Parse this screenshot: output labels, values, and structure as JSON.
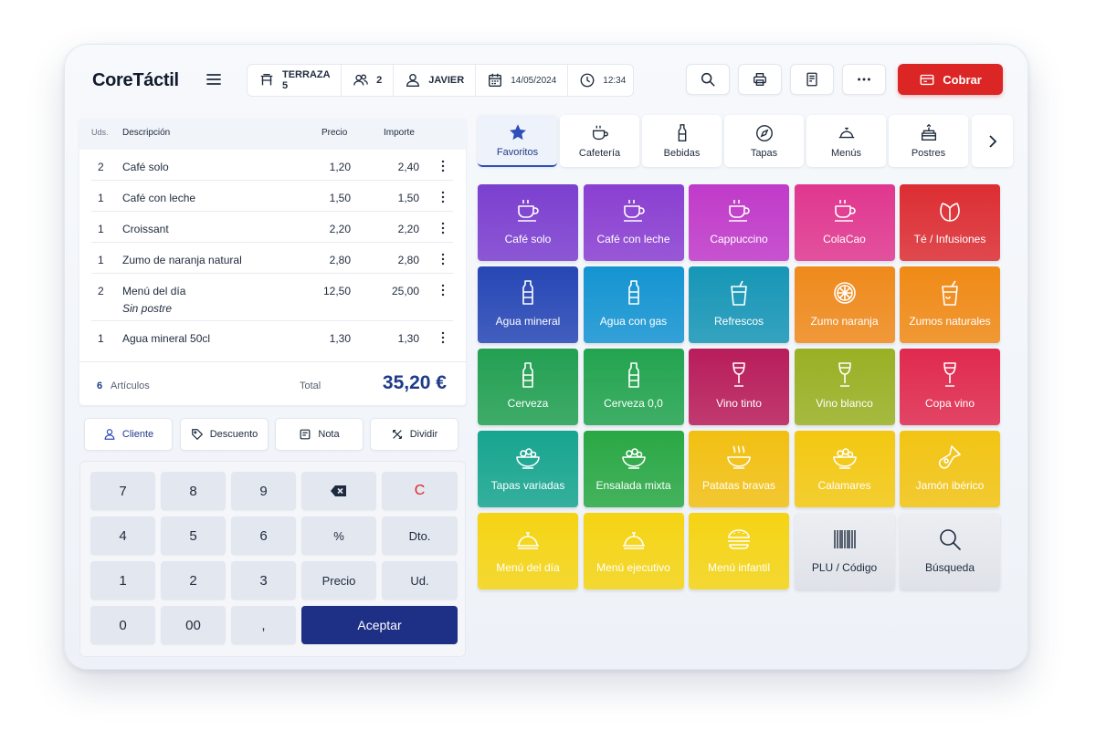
{
  "brand": "CoreTáctil",
  "info": {
    "table": "TERRAZA 5",
    "guests": "2",
    "waiter": "JAVIER",
    "date": "14/05/2024",
    "time": "12:34"
  },
  "cobrar_label": "Cobrar",
  "ticket": {
    "headers": {
      "units": "Uds.",
      "description": "Descripción",
      "price": "Precio",
      "amount": "Importe"
    },
    "rows": [
      {
        "qty": "2",
        "desc": "Café solo",
        "note": "",
        "price": "1,20",
        "amount": "2,40"
      },
      {
        "qty": "1",
        "desc": "Café con leche",
        "note": "",
        "price": "1,50",
        "amount": "1,50"
      },
      {
        "qty": "1",
        "desc": "Croissant",
        "note": "",
        "price": "2,20",
        "amount": "2,20"
      },
      {
        "qty": "1",
        "desc": "Zumo de naranja natural",
        "note": "",
        "price": "2,80",
        "amount": "2,80"
      },
      {
        "qty": "2",
        "desc": "Menú del día",
        "note": "Sin postre",
        "price": "12,50",
        "amount": "25,00"
      },
      {
        "qty": "1",
        "desc": "Agua mineral 50cl",
        "note": "",
        "price": "1,30",
        "amount": "1,30"
      }
    ],
    "count": "6",
    "count_label": "Artículos",
    "total_label": "Total",
    "total": "35,20 €"
  },
  "actions": {
    "cliente": "Cliente",
    "descuento": "Descuento",
    "nota": "Nota",
    "dividir": "Dividir"
  },
  "keypad": {
    "k7": "7",
    "k8": "8",
    "k9": "9",
    "clear": "C",
    "k4": "4",
    "k5": "5",
    "k6": "6",
    "percent": "%",
    "dto": "Dto.",
    "k1": "1",
    "k2": "2",
    "k3": "3",
    "precio": "Precio",
    "ud": "Ud.",
    "k0": "0",
    "k00": "00",
    "comma": ",",
    "aceptar": "Aceptar"
  },
  "categories": [
    "Favoritos",
    "Cafetería",
    "Bebidas",
    "Tapas",
    "Menús",
    "Postres"
  ],
  "products": [
    {
      "label": "Café solo",
      "icon": "cup-icon",
      "color": "#7c3fcf"
    },
    {
      "label": "Café con leche",
      "icon": "cup-icon",
      "color": "#8a3fd1"
    },
    {
      "label": "Cappuccino",
      "icon": "cup-icon",
      "color": "#c03ac9"
    },
    {
      "label": "ColaCao",
      "icon": "cup-icon",
      "color": "#e0378f"
    },
    {
      "label": "Té / Infusiones",
      "icon": "leaf-icon",
      "color": "#dc2e33"
    },
    {
      "label": "Agua mineral",
      "icon": "bottle-icon",
      "color": "#2747b5"
    },
    {
      "label": "Agua con gas",
      "icon": "bottle-icon",
      "color": "#1594d1"
    },
    {
      "label": "Refrescos",
      "icon": "soda-cup-icon",
      "color": "#1796b6"
    },
    {
      "label": "Zumo naranja",
      "icon": "orange-slice-icon",
      "color": "#ef8a1c"
    },
    {
      "label": "Zumos naturales",
      "icon": "juice-glass-icon",
      "color": "#f08a16"
    },
    {
      "label": "Cerveza",
      "icon": "beer-bottle-icon",
      "color": "#23a052"
    },
    {
      "label": "Cerveza 0,0",
      "icon": "beer-bottle-icon",
      "color": "#23a44f"
    },
    {
      "label": "Vino tinto",
      "icon": "wine-glass-icon",
      "color": "#b81d5a"
    },
    {
      "label": "Vino blanco",
      "icon": "wine-glass-icon",
      "color": "#9ab024"
    },
    {
      "label": "Copa vino",
      "icon": "wine-glass-icon",
      "color": "#e02a4e"
    },
    {
      "label": "Tapas variadas",
      "icon": "bowl-icon",
      "color": "#17a58f"
    },
    {
      "label": "Ensalada mixta",
      "icon": "bowl-icon",
      "color": "#2aa845"
    },
    {
      "label": "Patatas bravas",
      "icon": "steaming-bowl-icon",
      "color": "#f2c013"
    },
    {
      "label": "Calamares",
      "icon": "bowl-icon",
      "color": "#f3c812"
    },
    {
      "label": "Jamón ibérico",
      "icon": "ham-icon",
      "color": "#f2c414"
    },
    {
      "label": "Menú del día",
      "icon": "cloche-icon",
      "color": "#f5d414"
    },
    {
      "label": "Menú ejecutivo",
      "icon": "cloche-icon",
      "color": "#f5d414"
    },
    {
      "label": "Menú infantil",
      "icon": "burger-icon",
      "color": "#f5d414"
    },
    {
      "label": "PLU / Código",
      "icon": "barcode-icon",
      "color": "#e4e6eb"
    },
    {
      "label": "Búsqueda",
      "icon": "search-icon",
      "color": "#e4e6eb"
    }
  ]
}
